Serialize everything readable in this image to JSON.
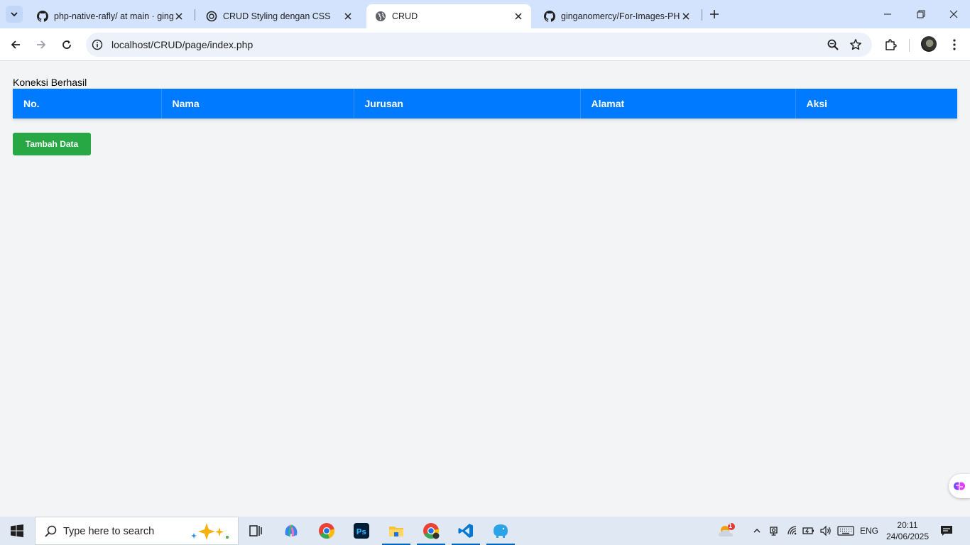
{
  "browser": {
    "tabs": [
      {
        "title": "php-native-rafly/ at main · gingar",
        "active": false,
        "icon": "github-icon"
      },
      {
        "title": "CRUD Styling dengan CSS",
        "active": false,
        "icon": "openai-icon"
      },
      {
        "title": "CRUD",
        "active": true,
        "icon": "globe-icon"
      },
      {
        "title": "ginganomercy/For-Images-PHP",
        "active": false,
        "icon": "github-icon"
      }
    ],
    "url": "localhost/CRUD/page/index.php"
  },
  "page": {
    "status_message": "Koneksi Berhasil",
    "table": {
      "columns": [
        "No.",
        "Nama",
        "Jurusan",
        "Alamat",
        "Aksi"
      ],
      "rows": []
    },
    "add_button_label": "Tambah Data"
  },
  "taskbar": {
    "search_placeholder": "Type here to search",
    "weather_badge": "1",
    "language": "ENG",
    "time": "20:11",
    "date": "24/06/2025"
  },
  "colors": {
    "table_header": "#007bff",
    "add_button": "#28a745",
    "tab_strip": "#d3e3fd",
    "page_bg": "#f3f4f6"
  }
}
